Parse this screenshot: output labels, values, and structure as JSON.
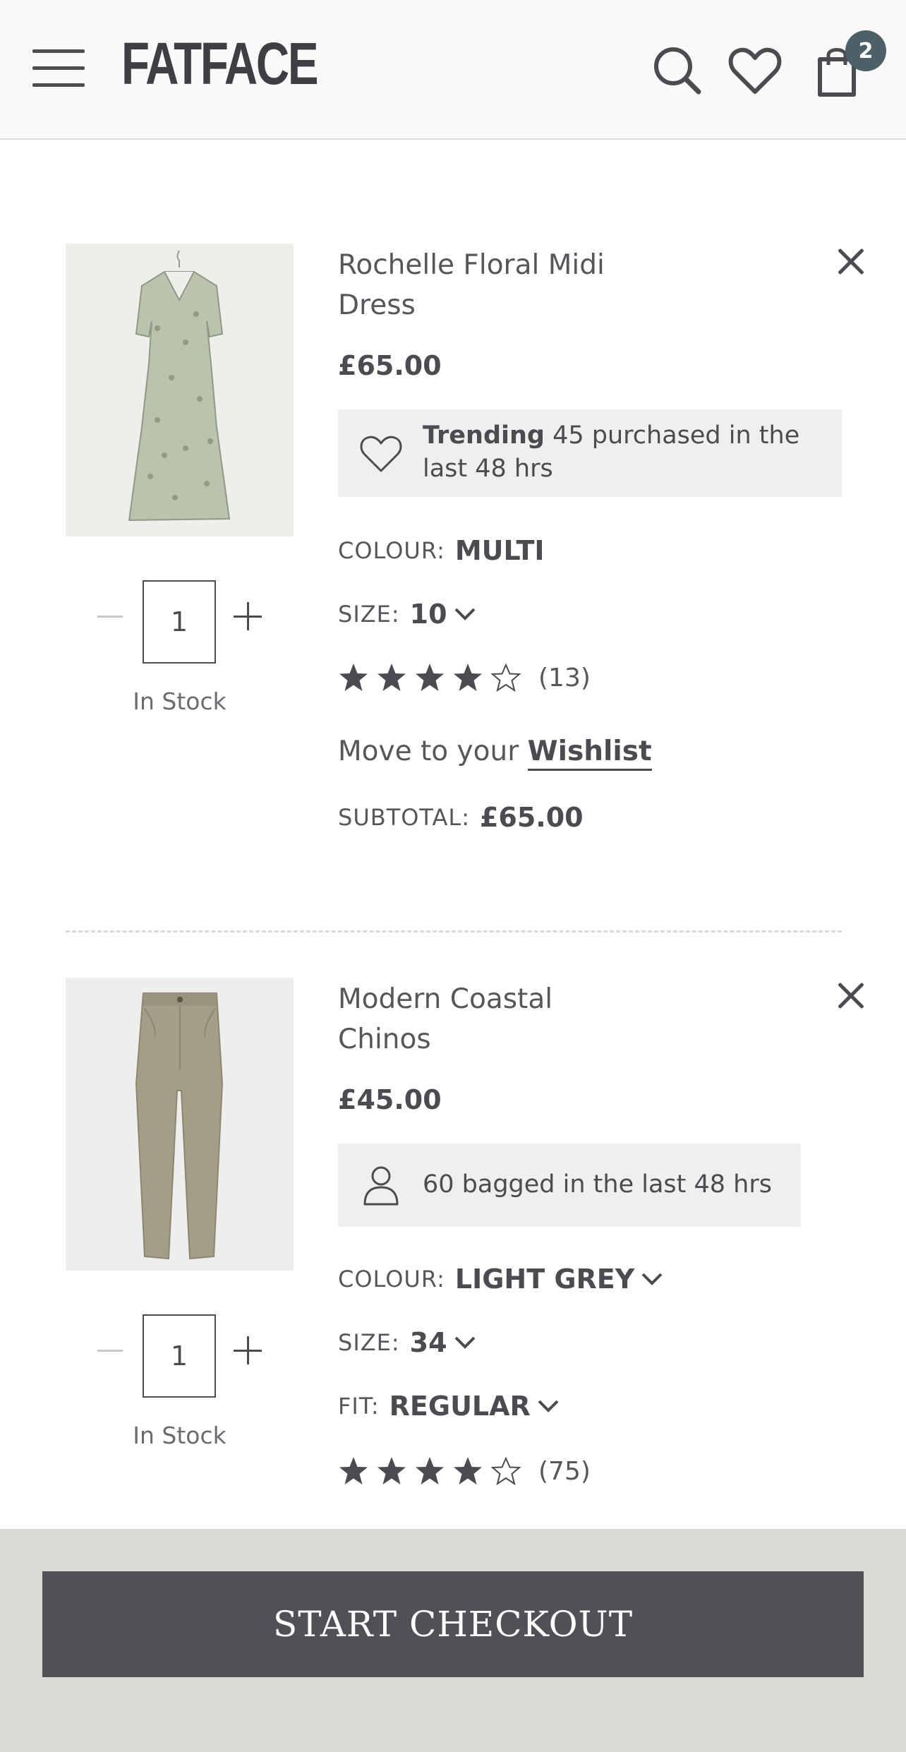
{
  "header": {
    "brand": "FATFACE",
    "bag_count": "2"
  },
  "items": [
    {
      "name": "Rochelle Floral Midi Dress",
      "price": "£65.00",
      "promo_bold": "Trending",
      "promo_text": "45 purchased in the last 48 hrs",
      "promo_icon": "heart-icon",
      "colour_label": "COLOUR:",
      "colour_value": "MULTI",
      "size_label": "SIZE:",
      "size_value": "10",
      "rating": 4,
      "review_count": "(13)",
      "wishlist_prefix": "Move to your",
      "wishlist_link": "Wishlist",
      "subtotal_label": "SUBTOTAL:",
      "subtotal_value": "£65.00",
      "quantity": "1",
      "stock": "In Stock"
    },
    {
      "name": "Modern Coastal Chinos",
      "price": "£45.00",
      "promo_text": "60 bagged in the last 48 hrs",
      "promo_icon": "person-icon",
      "colour_label": "COLOUR:",
      "colour_value": "LIGHT GREY",
      "size_label": "SIZE:",
      "size_value": "34",
      "fit_label": "FIT:",
      "fit_value": "REGULAR",
      "rating": 4,
      "review_count": "(75)",
      "quantity": "1",
      "stock": "In Stock"
    }
  ],
  "footer": {
    "checkout_label": "START CHECKOUT"
  },
  "colors": {
    "text": "#4a4c50",
    "badge": "#4d6068",
    "checkout_button": "#4f5157",
    "footer_bg": "#d8dbd5",
    "promo_bg": "#efefef"
  }
}
